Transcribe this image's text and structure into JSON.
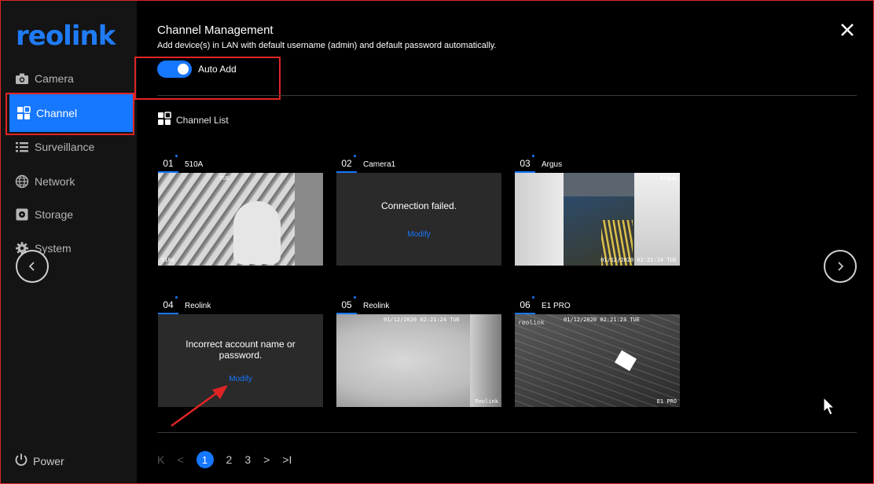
{
  "sidebar": {
    "logo": "reolink",
    "items": [
      {
        "label": "Camera",
        "icon": "camera-icon"
      },
      {
        "label": "Channel",
        "icon": "channel-grid-icon"
      },
      {
        "label": "Surveillance",
        "icon": "list-icon"
      },
      {
        "label": "Network",
        "icon": "globe-icon"
      },
      {
        "label": "Storage",
        "icon": "storage-icon"
      },
      {
        "label": "System",
        "icon": "gear-icon"
      }
    ],
    "active": "Channel",
    "power_label": "Power"
  },
  "header": {
    "title": "Channel Management",
    "subtitle": "Add device(s) in LAN with default username (admin) and default password automatically."
  },
  "auto_add": {
    "label": "Auto Add",
    "enabled": true
  },
  "channel_list": {
    "title": "Channel List",
    "cards": [
      {
        "num": "01",
        "name": "510A",
        "status": "image",
        "osd_top": "TUE",
        "osd_bottom": "510A"
      },
      {
        "num": "02",
        "name": "Camera1",
        "status": "error",
        "message": "Connection failed.",
        "action": "Modify"
      },
      {
        "num": "03",
        "name": "Argus",
        "status": "image",
        "osd_top": "Argus",
        "osd_bottom": "01/12/2020 02:21:24 TUE"
      },
      {
        "num": "04",
        "name": "Reolink",
        "status": "error",
        "message": "Incorrect account name or password.",
        "action": "Modify"
      },
      {
        "num": "05",
        "name": "Reolink",
        "status": "image",
        "osd_top": "01/12/2020 02:21:24 TUE",
        "osd_bottom": "Reolink"
      },
      {
        "num": "06",
        "name": "E1 PRO",
        "status": "image",
        "osd_top": "01/12/2020 02:21:23 TUE",
        "osd_bottom": "E1 PRO",
        "osd_logo": "reolink"
      }
    ]
  },
  "pagination": {
    "first": "K",
    "prev": "<",
    "pages": [
      "1",
      "2",
      "3"
    ],
    "current": "1",
    "next": ">",
    "last": ">I"
  },
  "colors": {
    "accent": "#1677ff",
    "sidebar_bg": "#141414",
    "annotation": "#e02424"
  }
}
